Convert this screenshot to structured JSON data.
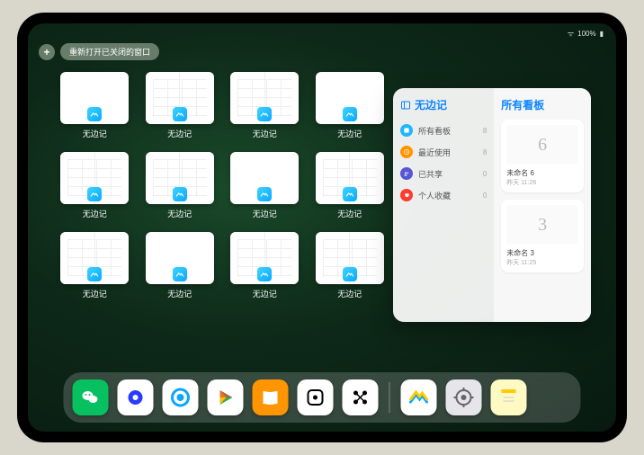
{
  "status": {
    "time": "",
    "battery": "100%"
  },
  "topbar": {
    "close": "+",
    "reopen_label": "重新打开已关闭的窗口"
  },
  "app_name": "无边记",
  "windows": [
    {
      "label": "无边记",
      "split": false
    },
    {
      "label": "无边记",
      "split": true
    },
    {
      "label": "无边记",
      "split": true
    },
    {
      "label": "无边记",
      "split": false
    },
    {
      "label": "无边记",
      "split": true
    },
    {
      "label": "无边记",
      "split": true
    },
    {
      "label": "无边记",
      "split": false
    },
    {
      "label": "无边记",
      "split": true
    },
    {
      "label": "无边记",
      "split": true
    },
    {
      "label": "无边记",
      "split": false
    },
    {
      "label": "无边记",
      "split": true
    },
    {
      "label": "无边记",
      "split": true
    }
  ],
  "popover": {
    "left_title": "无边记",
    "right_title": "所有看板",
    "categories": [
      {
        "label": "所有看板",
        "count": 8,
        "color": "#1fb6ff"
      },
      {
        "label": "最近使用",
        "count": 8,
        "color": "#ff9500"
      },
      {
        "label": "已共享",
        "count": 0,
        "color": "#5856d6"
      },
      {
        "label": "个人收藏",
        "count": 0,
        "color": "#ff3b30"
      }
    ],
    "boards": [
      {
        "name": "未命名 6",
        "time": "昨天 11:26",
        "glyph": "6"
      },
      {
        "name": "未命名 3",
        "time": "昨天 11:25",
        "glyph": "3"
      }
    ]
  },
  "dock": {
    "apps": [
      {
        "name": "wechat",
        "bg": "#07c160"
      },
      {
        "name": "quark",
        "bg": "#ffffff"
      },
      {
        "name": "qqbrowser",
        "bg": "#ffffff"
      },
      {
        "name": "play",
        "bg": "#ffffff"
      },
      {
        "name": "books",
        "bg": "#ff9500"
      },
      {
        "name": "dice",
        "bg": "#ffffff"
      },
      {
        "name": "connect",
        "bg": "#ffffff"
      },
      {
        "name": "freeform",
        "bg": "#ffffff"
      },
      {
        "name": "settings",
        "bg": "#e5e5ea"
      },
      {
        "name": "notes",
        "bg": "#fff9c4"
      }
    ]
  }
}
